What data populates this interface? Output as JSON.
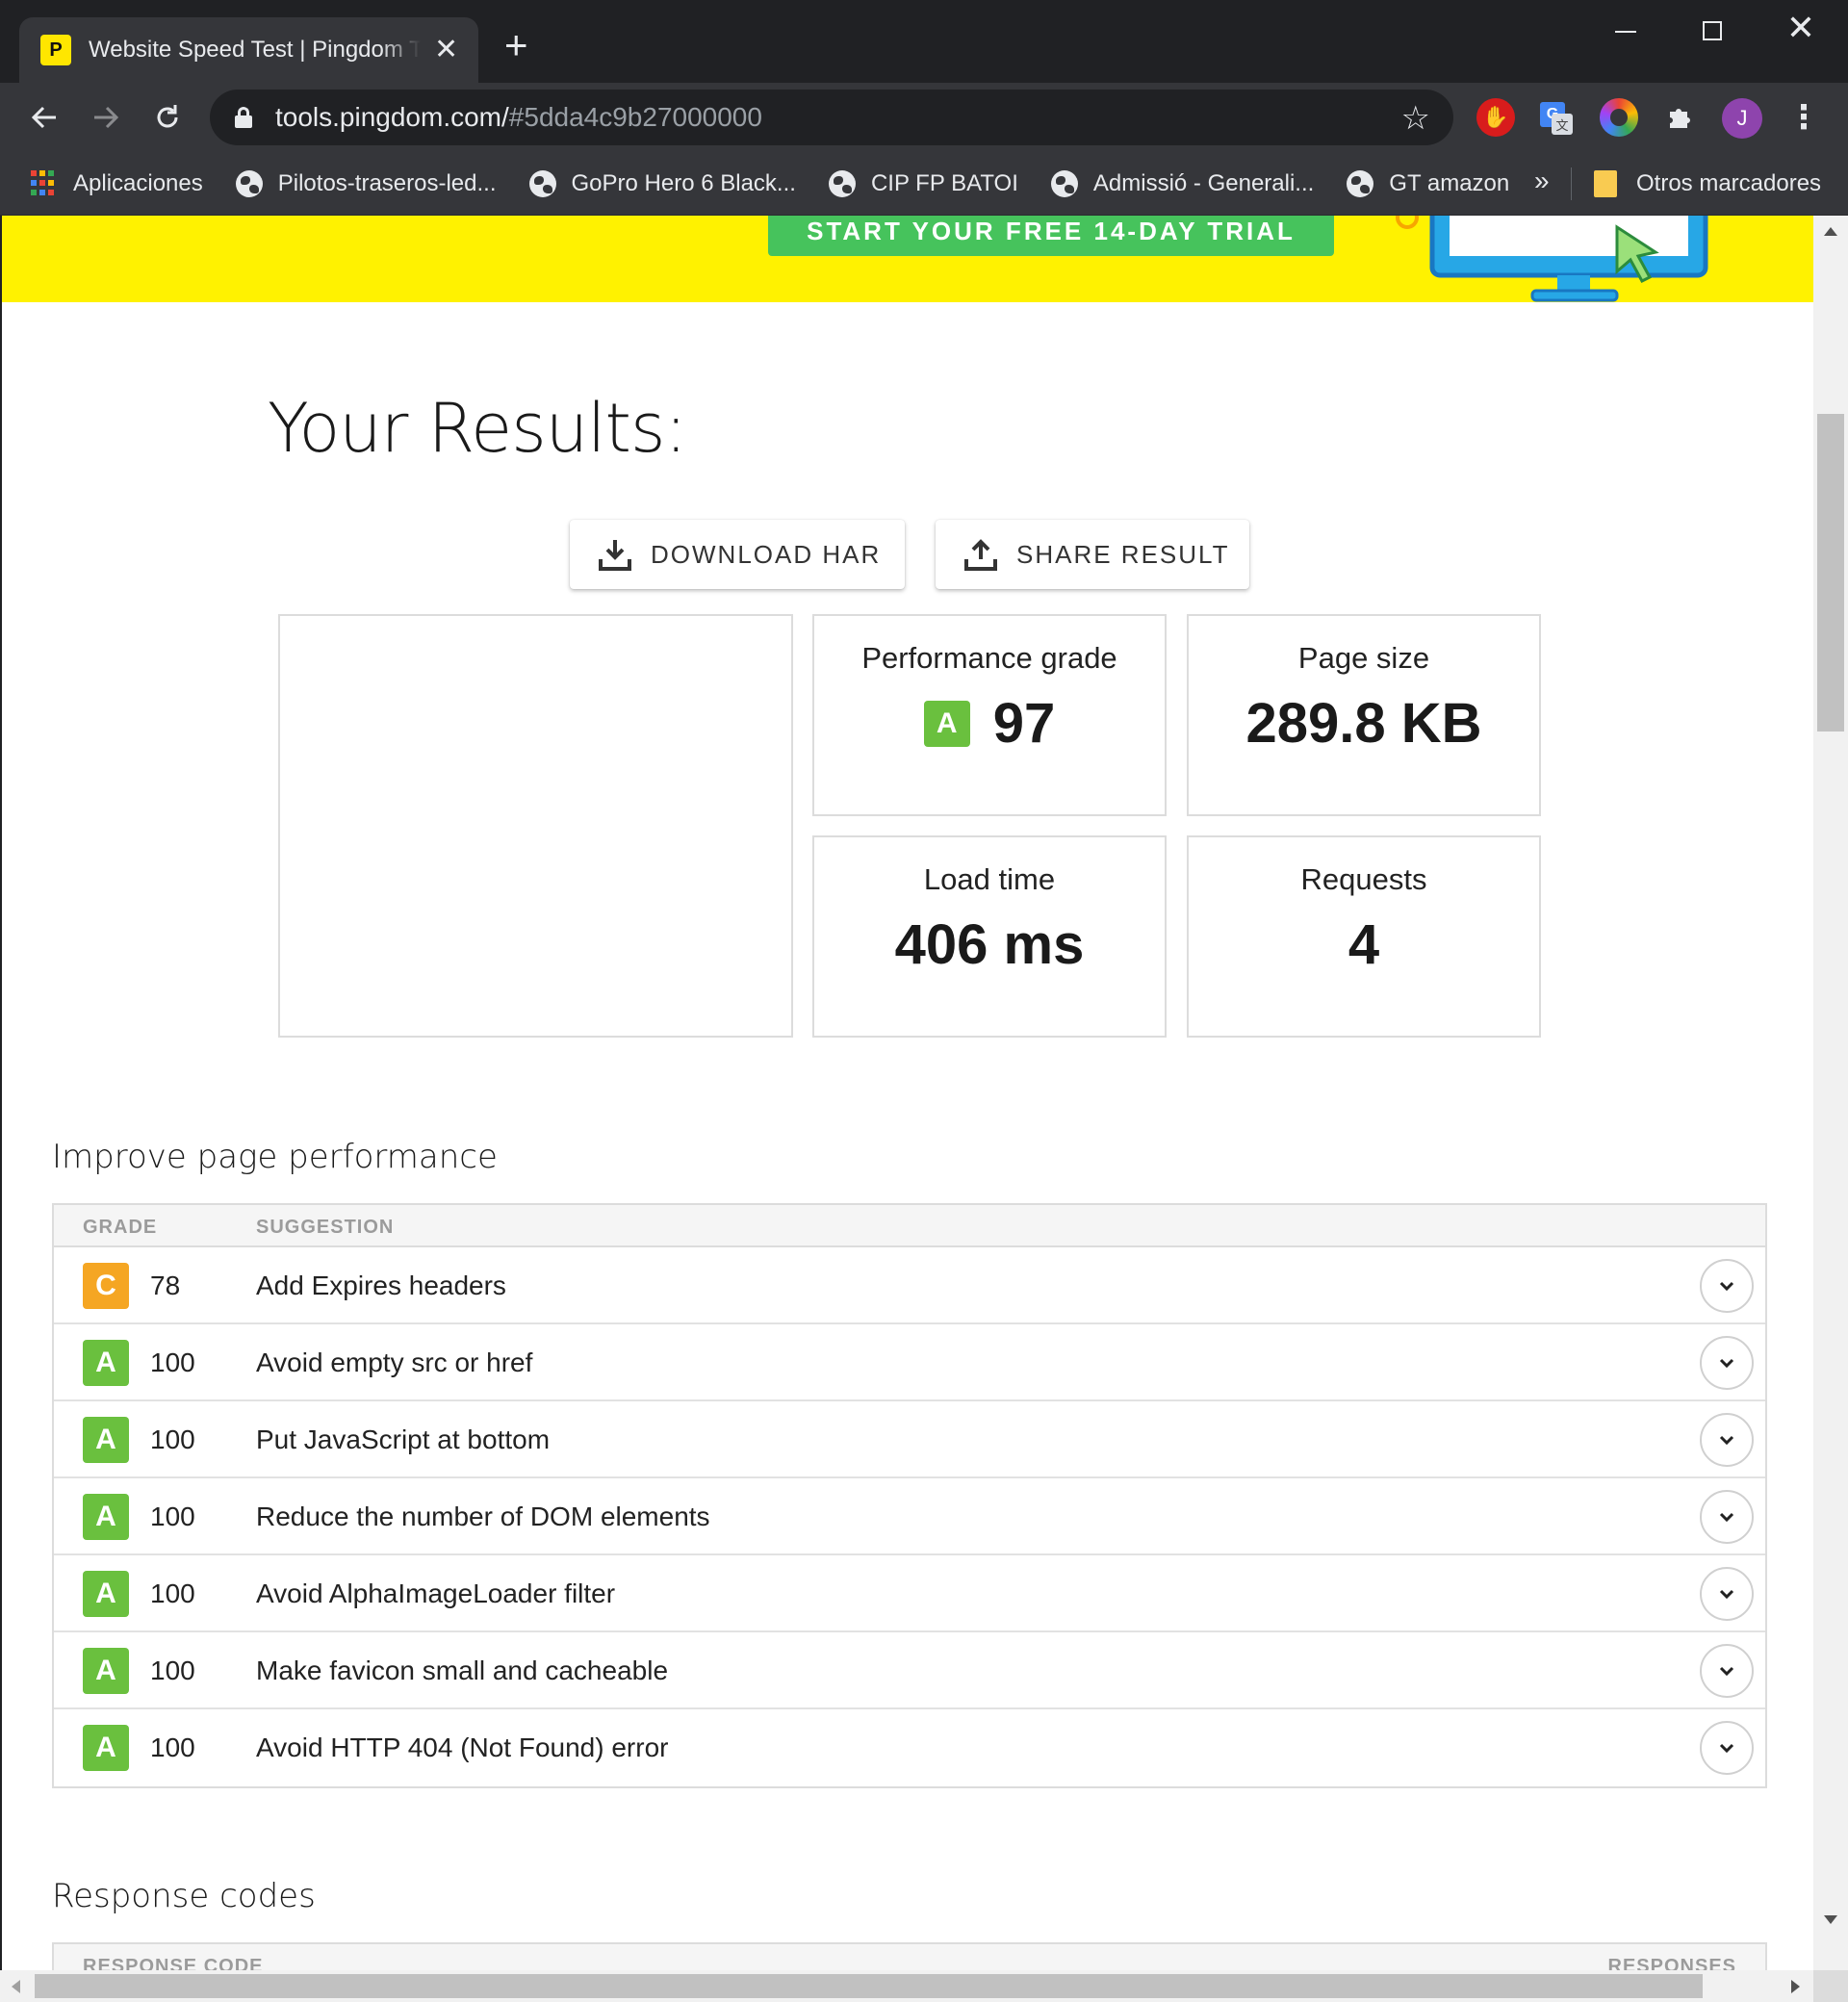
{
  "browser": {
    "tab": {
      "favicon_letter": "P",
      "title": "Website Speed Test | Pingdom Tools"
    },
    "url": {
      "host": "tools.pingdom.com/",
      "path": "#5dda4c9b27000000"
    },
    "avatar_letter": "J",
    "bookmarks": [
      {
        "label": "Aplicaciones",
        "icon": "apps-icon"
      },
      {
        "label": "Pilotos-traseros-led...",
        "icon": "globe-icon"
      },
      {
        "label": "GoPro Hero 6 Black...",
        "icon": "globe-icon"
      },
      {
        "label": "CIP FP BATOI",
        "icon": "globe-icon"
      },
      {
        "label": "Admissió - Generali...",
        "icon": "globe-icon"
      },
      {
        "label": "GT amazon",
        "icon": "globe-icon"
      }
    ],
    "bookmarks_more": "»",
    "other_bookmarks": "Otros marcadores"
  },
  "promo": {
    "button_label": "START YOUR FREE 14-DAY TRIAL"
  },
  "results": {
    "title": "Your Results:",
    "download_label": "DOWNLOAD HAR",
    "share_label": "SHARE RESULT",
    "performance": {
      "label": "Performance grade",
      "grade": "A",
      "value": "97"
    },
    "page_size": {
      "label": "Page size",
      "value": "289.8 KB"
    },
    "load_time": {
      "label": "Load time",
      "value": "406 ms"
    },
    "requests": {
      "label": "Requests",
      "value": "4"
    }
  },
  "improve": {
    "title": "Improve page performance",
    "col_grade": "GRADE",
    "col_suggestion": "SUGGESTION",
    "rows": [
      {
        "grade": "C",
        "score": "78",
        "suggestion": "Add Expires headers",
        "color": "#f5a623"
      },
      {
        "grade": "A",
        "score": "100",
        "suggestion": "Avoid empty src or href",
        "color": "#6ac03e"
      },
      {
        "grade": "A",
        "score": "100",
        "suggestion": "Put JavaScript at bottom",
        "color": "#6ac03e"
      },
      {
        "grade": "A",
        "score": "100",
        "suggestion": "Reduce the number of DOM elements",
        "color": "#6ac03e"
      },
      {
        "grade": "A",
        "score": "100",
        "suggestion": "Avoid AlphaImageLoader filter",
        "color": "#6ac03e"
      },
      {
        "grade": "A",
        "score": "100",
        "suggestion": "Make favicon small and cacheable",
        "color": "#6ac03e"
      },
      {
        "grade": "A",
        "score": "100",
        "suggestion": "Avoid HTTP 404 (Not Found) error",
        "color": "#6ac03e"
      }
    ]
  },
  "response_codes": {
    "title": "Response codes",
    "col_code": "RESPONSE CODE",
    "col_responses": "RESPONSES"
  },
  "colors": {
    "promo_bg": "#fff200",
    "promo_button": "#46c35c",
    "grade_a": "#6ac03e",
    "grade_c": "#f5a623"
  }
}
